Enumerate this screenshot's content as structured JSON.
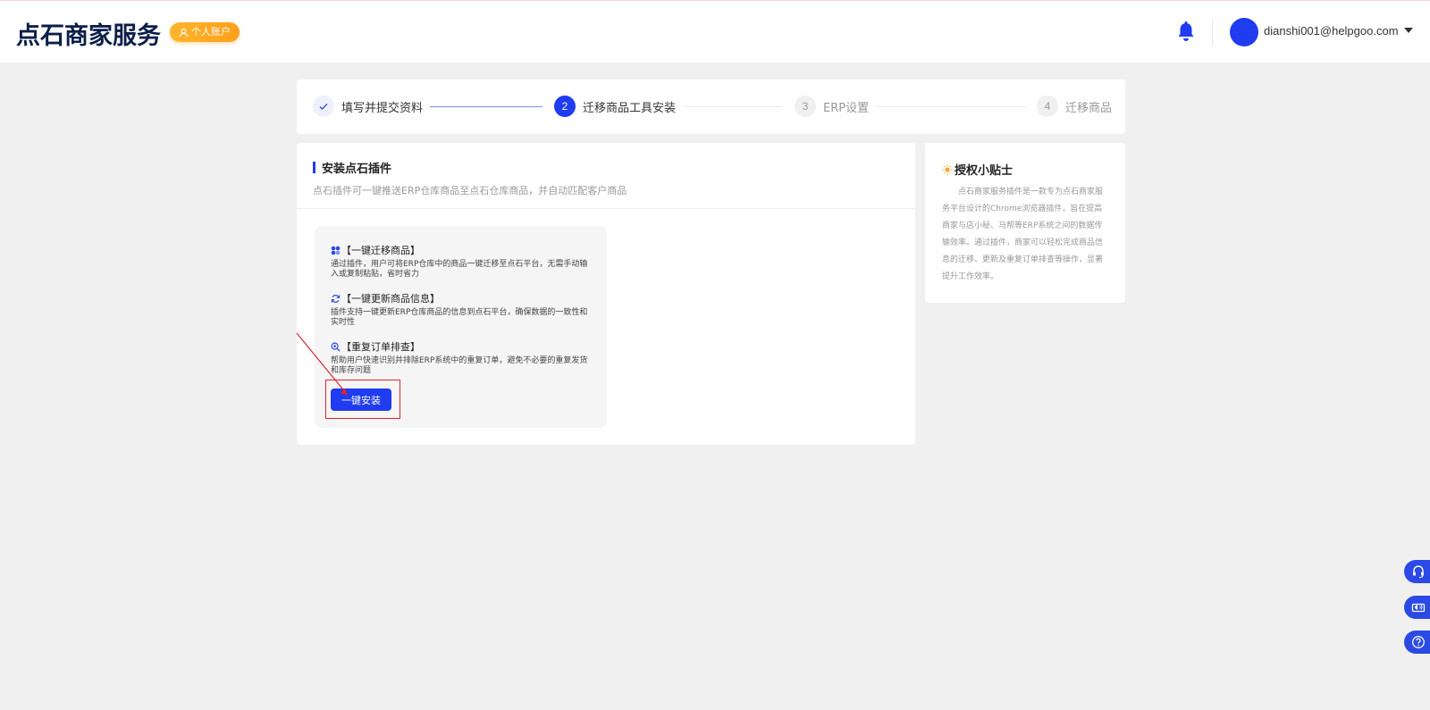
{
  "header": {
    "logo": "点石商家服务",
    "account_badge": "个人账户",
    "user_email": "dianshi001@helpgoo.com"
  },
  "steps": [
    {
      "index": "✓",
      "label": "填写并提交资料",
      "state": "done"
    },
    {
      "index": "2",
      "label": "迁移商品工具安装",
      "state": "active"
    },
    {
      "index": "3",
      "label": "ERP设置",
      "state": "todo"
    },
    {
      "index": "4",
      "label": "迁移商品",
      "state": "todo"
    }
  ],
  "install": {
    "title": "安装点石插件",
    "description": "点石插件可一键推送ERP仓库商品至点石仓库商品，并自动匹配客户商品",
    "features": [
      {
        "icon": "apps-icon",
        "title": "【一键迁移商品】",
        "desc": "通过插件，用户可将ERP仓库中的商品一键迁移至点石平台，无需手动输入或复制粘贴，省时省力"
      },
      {
        "icon": "refresh-icon",
        "title": "【一键更新商品信息】",
        "desc": "插件支持一键更新ERP仓库商品的信息到点石平台，确保数据的一致性和实时性"
      },
      {
        "icon": "search-icon",
        "title": "【重复订单排查】",
        "desc": "帮助用户快速识别并排除ERP系统中的重复订单，避免不必要的重复发货和库存问题"
      }
    ],
    "button_label": "一键安装"
  },
  "tips": {
    "title": "授权小贴士",
    "body": "点石商家服务插件是一款专为点石商家服务平台设计的Chrome浏览器插件，旨在提高商家与店小秘、马帮等ERP系统之间的数据传输效率。通过插件，商家可以轻松完成商品信息的迁移、更新及重复订单排查等操作，显著提升工作效率。"
  },
  "colors": {
    "primary": "#1f3cf0",
    "badge": "#ffa51f",
    "annotation": "#e0242c"
  }
}
